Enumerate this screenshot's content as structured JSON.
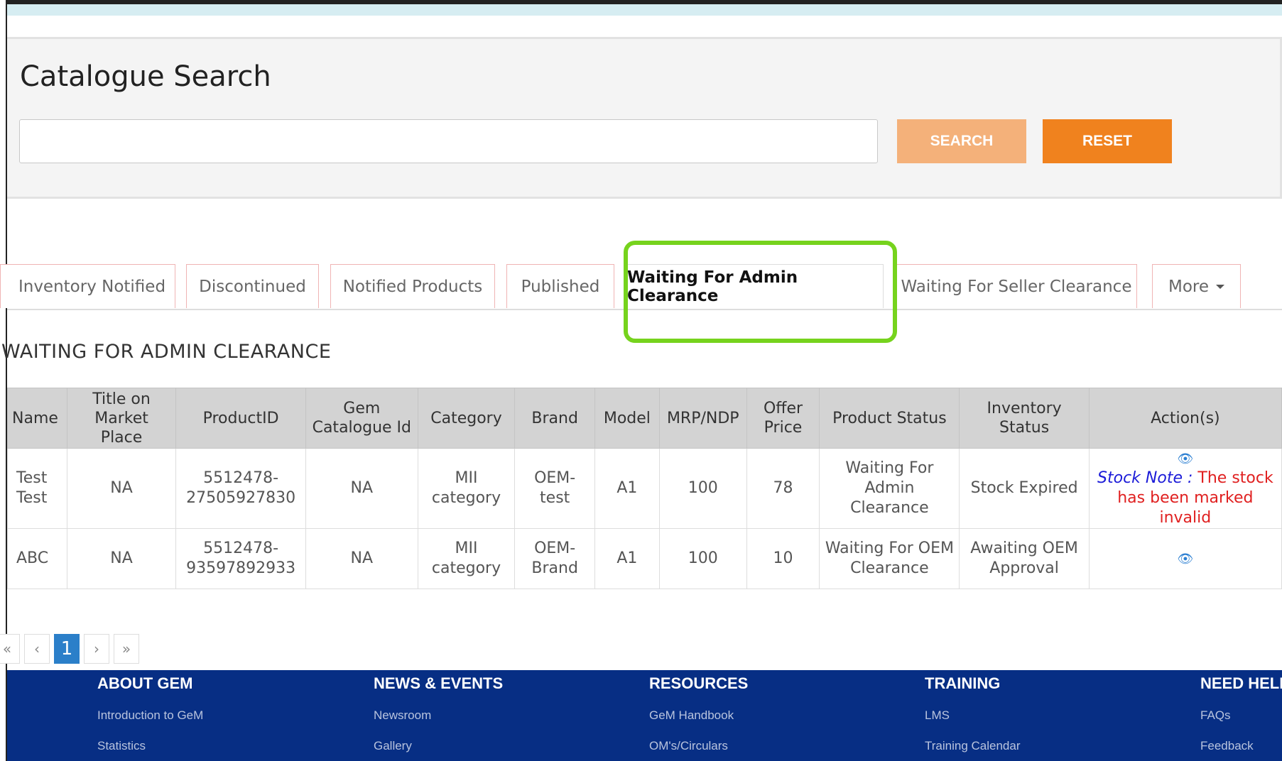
{
  "search": {
    "title": "Catalogue Search",
    "input_value": "",
    "search_label": "SEARCH",
    "reset_label": "RESET"
  },
  "tabs": [
    {
      "label": "Inventory Notified"
    },
    {
      "label": "Discontinued"
    },
    {
      "label": "Notified Products"
    },
    {
      "label": "Published"
    },
    {
      "label": "Waiting For Admin Clearance",
      "active": true
    },
    {
      "label": "Waiting For Seller Clearance"
    },
    {
      "label": "More"
    }
  ],
  "section_title": "WAITING FOR ADMIN CLEARANCE",
  "table": {
    "headers": [
      "Name",
      "Title on Market Place",
      "ProductID",
      "Gem Catalogue Id",
      "Category",
      "Brand",
      "Model",
      "MRP/NDP",
      "Offer Price",
      "Product Status",
      "Inventory Status",
      "Action(s)"
    ],
    "rows": [
      {
        "name": "Test Test",
        "title": "NA",
        "product_id": "5512478-27505927830",
        "gem_id": "NA",
        "category": "MII category",
        "brand": "OEM-test",
        "model": "A1",
        "mrp": "100",
        "offer": "78",
        "product_status": "Waiting For Admin Clearance",
        "inventory_status": "Stock Expired",
        "stock_note_label": "Stock Note :",
        "stock_note_text": "The stock has been marked invalid"
      },
      {
        "name": "ABC",
        "title": "NA",
        "product_id": "5512478-93597892933",
        "gem_id": "NA",
        "category": "MII category",
        "brand": "OEM-Brand",
        "model": "A1",
        "mrp": "100",
        "offer": "10",
        "product_status": "Waiting For OEM Clearance",
        "inventory_status": "Awaiting OEM Approval"
      }
    ]
  },
  "pagination": {
    "first": "«",
    "prev": "‹",
    "current": "1",
    "next": "›",
    "last": "»"
  },
  "footer": {
    "columns": [
      {
        "heading": "ABOUT GEM",
        "links": [
          "Introduction to GeM",
          "Statistics"
        ]
      },
      {
        "heading": "NEWS & EVENTS",
        "links": [
          "Newsroom",
          "Gallery"
        ]
      },
      {
        "heading": "RESOURCES",
        "links": [
          "GeM Handbook",
          "OM's/Circulars"
        ]
      },
      {
        "heading": "TRAINING",
        "links": [
          "LMS",
          "Training Calendar"
        ]
      },
      {
        "heading": "NEED HELP",
        "links": [
          "FAQs",
          "Feedback"
        ]
      }
    ]
  },
  "colors": {
    "search_btn": "#f4b17a",
    "reset_btn": "#f0821e",
    "footer_bg": "#072e84",
    "highlight": "#76d31d",
    "page_active": "#2b7fc9"
  }
}
